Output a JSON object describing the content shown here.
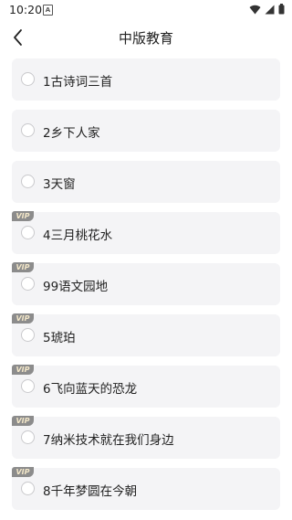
{
  "status_bar": {
    "time": "10:20",
    "notif_icon": "A"
  },
  "header": {
    "title": "中版教育",
    "back_icon": "chevron-left-icon"
  },
  "lessons": [
    {
      "label": "1古诗词三首",
      "vip": false
    },
    {
      "label": "2乡下人家",
      "vip": false
    },
    {
      "label": "3天窗",
      "vip": false
    },
    {
      "label": "4三月桃花水",
      "vip": true
    },
    {
      "label": "99语文园地",
      "vip": true
    },
    {
      "label": "5琥珀",
      "vip": true
    },
    {
      "label": "6飞向蓝天的恐龙",
      "vip": true
    },
    {
      "label": "7纳米技术就在我们身边",
      "vip": true
    },
    {
      "label": "8千年梦圆在今朝",
      "vip": true
    }
  ],
  "vip_text": "VIP"
}
